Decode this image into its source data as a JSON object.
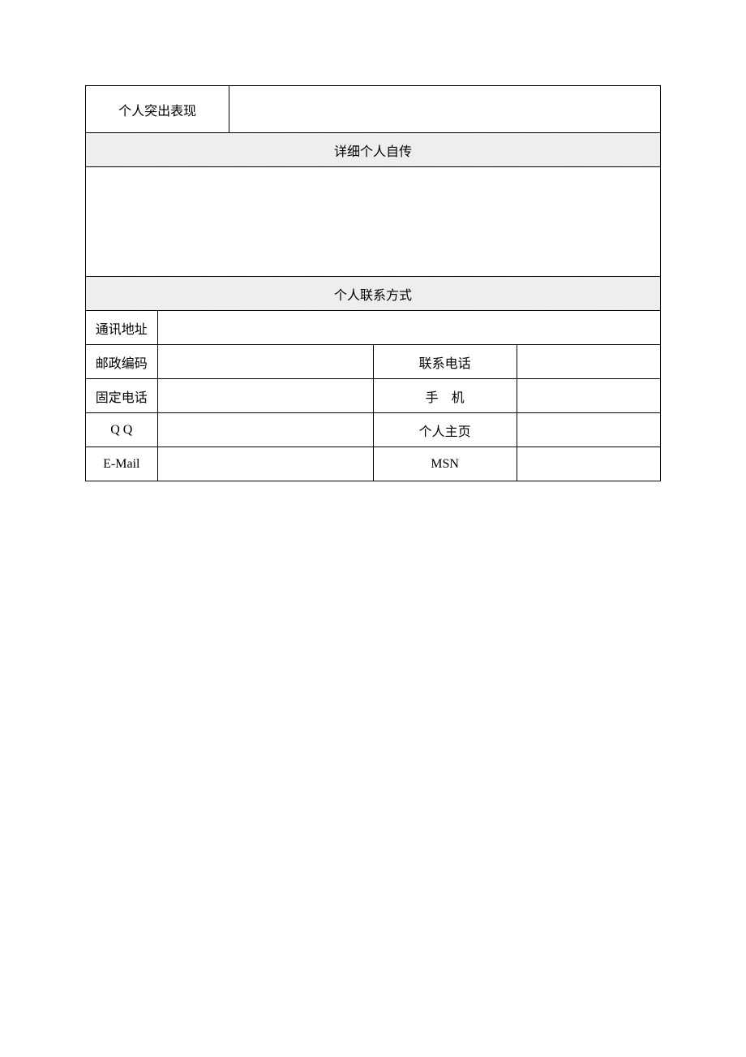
{
  "row1": {
    "label": "个人突出表现",
    "value": ""
  },
  "section_autobio": {
    "header": "详细个人自传",
    "content": ""
  },
  "section_contact": {
    "header": "个人联系方式"
  },
  "contact": {
    "address": {
      "label": "通讯地址",
      "value": ""
    },
    "postal": {
      "label": "邮政编码",
      "value": ""
    },
    "phone": {
      "label": "联系电话",
      "value": ""
    },
    "landline": {
      "label": "固定电话",
      "value": ""
    },
    "mobile": {
      "label": "手　机",
      "value": ""
    },
    "qq": {
      "label": "Q Q",
      "value": ""
    },
    "homepage": {
      "label": "个人主页",
      "value": ""
    },
    "email": {
      "label": "E-Mail",
      "value": ""
    },
    "msn": {
      "label": "MSN",
      "value": ""
    }
  }
}
